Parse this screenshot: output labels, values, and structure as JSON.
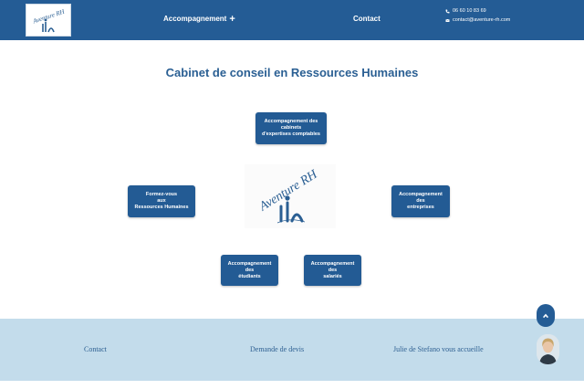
{
  "header": {
    "logo_text": "Aventure RH",
    "nav": [
      {
        "label": "Accompagnement",
        "suffix": "+"
      },
      {
        "label": "Contact"
      }
    ],
    "phone": "06 60 10 83 69",
    "email": "contact@aventure-rh.com",
    "icons": {
      "phone": "phone-icon",
      "email": "envelope-icon"
    }
  },
  "main": {
    "title": "Cabinet de conseil en Ressources Humaines",
    "center_logo_text": "Aventure RH",
    "services": {
      "cabinets": [
        "Accompagnement des",
        "cabinets",
        "d'expertises comptables"
      ],
      "formez": [
        "Formez-vous",
        "aux",
        "Ressources Humaines"
      ],
      "entreprises": [
        "Accompagnement",
        "des",
        "entreprises"
      ],
      "etudiants": [
        "Accompagnement",
        "des",
        "étudiants"
      ],
      "salaries": [
        "Accompagnement",
        "des",
        "salariés"
      ]
    }
  },
  "footer": {
    "links": [
      "Contact",
      "Demande de devis",
      "Julie de Stefano vous accueille"
    ]
  },
  "widgets": {
    "scroll_top_icon": "chevron-up-icon",
    "avatar": "julie-avatar"
  },
  "colors": {
    "primary": "#245c95",
    "footer_bg": "#c3dceb",
    "title": "#2a5f93"
  }
}
